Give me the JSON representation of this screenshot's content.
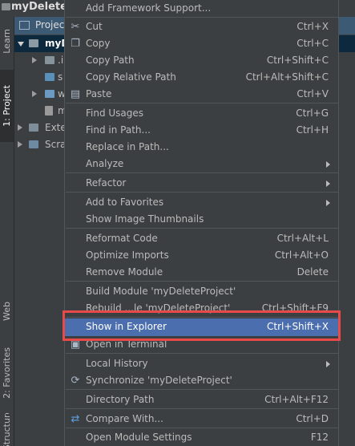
{
  "window": {
    "title": "myDelete"
  },
  "left_strip": {
    "tabs": [
      "Learn",
      "1: Project",
      "Web",
      "2: Favorites",
      "Structure"
    ]
  },
  "project_panel": {
    "header": "Projec",
    "rows": [
      "myD",
      ".i",
      "s",
      "w",
      "m",
      "Exte",
      "Scra"
    ]
  },
  "menu": {
    "items": {
      "add_framework": {
        "label": "Add Framework Support..."
      },
      "cut": {
        "label": "Cut",
        "shortcut": "Ctrl+X"
      },
      "copy": {
        "label": "Copy",
        "shortcut": "Ctrl+C"
      },
      "copy_path": {
        "label": "Copy Path",
        "shortcut": "Ctrl+Shift+C"
      },
      "copy_relative_path": {
        "label": "Copy Relative Path",
        "shortcut": "Ctrl+Alt+Shift+C"
      },
      "paste": {
        "label": "Paste",
        "shortcut": "Ctrl+V"
      },
      "find_usages": {
        "label": "Find Usages",
        "shortcut": "Ctrl+G"
      },
      "find_in_path": {
        "label": "Find in Path...",
        "shortcut": "Ctrl+H"
      },
      "replace_in_path": {
        "label": "Replace in Path..."
      },
      "analyze": {
        "label": "Analyze"
      },
      "refactor": {
        "label": "Refactor"
      },
      "add_to_favorites": {
        "label": "Add to Favorites"
      },
      "show_image_thumbnails": {
        "label": "Show Image Thumbnails"
      },
      "reformat_code": {
        "label": "Reformat Code",
        "shortcut": "Ctrl+Alt+L"
      },
      "optimize_imports": {
        "label": "Optimize Imports",
        "shortcut": "Ctrl+Alt+O"
      },
      "remove_module": {
        "label": "Remove Module",
        "shortcut": "Delete"
      },
      "build_module": {
        "label": "Build Module 'myDeleteProject'"
      },
      "rebuild_module": {
        "label": "Rebuild ...le 'myDeleteProject'",
        "shortcut": "Ctrl+Shift+F9"
      },
      "show_in_explorer": {
        "label": "Show in Explorer",
        "shortcut": "Ctrl+Shift+X"
      },
      "open_in_terminal": {
        "label": "Open in Terminal"
      },
      "local_history": {
        "label": "Local History"
      },
      "synchronize": {
        "label": "Synchronize 'myDeleteProject'"
      },
      "directory_path": {
        "label": "Directory Path",
        "shortcut": "Ctrl+Alt+F12"
      },
      "compare_with": {
        "label": "Compare With...",
        "shortcut": "Ctrl+D"
      },
      "open_module_settings": {
        "label": "Open Module Settings",
        "shortcut": "F12"
      }
    }
  },
  "colors": {
    "menu_bg": "#3c3f41",
    "highlight": "#4b6eaf",
    "annotation_box": "#e84a4a"
  }
}
